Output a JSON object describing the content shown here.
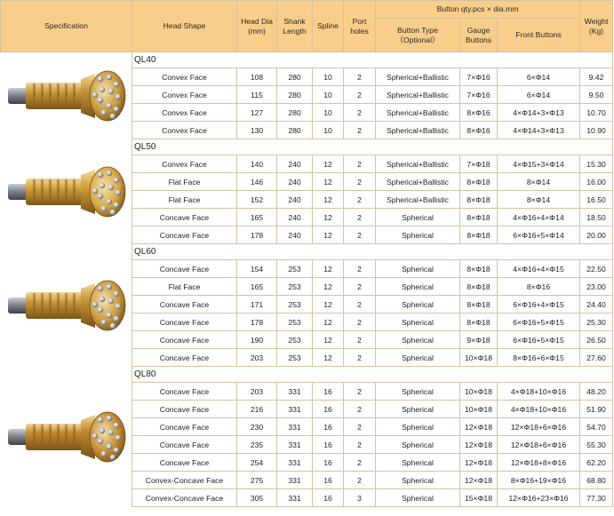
{
  "header": {
    "specification": "Specification",
    "head_shape": "Head Shape",
    "head_dia": "Head Dia\n(mm)",
    "shank_length": "Shank\nLength",
    "spline": "Spline",
    "port_holes": "Port\nholes",
    "button_group": "Button qty.pcs × dia.mm",
    "button_type": "Button Type\n（Optional）",
    "gauge_buttons": "Gauge\nButtons",
    "front_buttons": "Front Buttons",
    "weight": "Weight\n(Kg)"
  },
  "groups": [
    {
      "name": "QL40",
      "rows": [
        {
          "shape": "Convex Face",
          "dia": "108",
          "shank": "280",
          "spline": "10",
          "ports": "2",
          "type": "Spherical+Ballistic",
          "gauge": "7×Φ16",
          "front": "6×Φ14",
          "weight": "9.42"
        },
        {
          "shape": "Convex Face",
          "dia": "115",
          "shank": "280",
          "spline": "10",
          "ports": "2",
          "type": "Spherical+Ballistic",
          "gauge": "7×Φ16",
          "front": "6×Φ14",
          "weight": "9.50"
        },
        {
          "shape": "Convex Face",
          "dia": "127",
          "shank": "280",
          "spline": "10",
          "ports": "2",
          "type": "Spherical+Ballistic",
          "gauge": "8×Φ16",
          "front": "4×Φ14+3×Φ13",
          "weight": "10.70"
        },
        {
          "shape": "Convex Face",
          "dia": "130",
          "shank": "280",
          "spline": "10",
          "ports": "2",
          "type": "Spherical+Ballistic",
          "gauge": "8×Φ16",
          "front": "4×Φ14+3×Φ13",
          "weight": "10.90"
        }
      ]
    },
    {
      "name": "QL50",
      "rows": [
        {
          "shape": "Convex Face",
          "dia": "140",
          "shank": "240",
          "spline": "12",
          "ports": "2",
          "type": "Spherical+Ballistic",
          "gauge": "7×Φ18",
          "front": "4×Φ15+3×Φ14",
          "weight": "15.30"
        },
        {
          "shape": "Flat Face",
          "dia": "146",
          "shank": "240",
          "spline": "12",
          "ports": "2",
          "type": "Spherical+Ballistic",
          "gauge": "8×Φ18",
          "front": "8×Φ14",
          "weight": "16.00"
        },
        {
          "shape": "Flat Face",
          "dia": "152",
          "shank": "240",
          "spline": "12",
          "ports": "2",
          "type": "Spherical+Ballistic",
          "gauge": "8×Φ18",
          "front": "8×Φ14",
          "weight": "16.50"
        },
        {
          "shape": "Concave Face",
          "dia": "165",
          "shank": "240",
          "spline": "12",
          "ports": "2",
          "type": "Spherical",
          "gauge": "8×Φ18",
          "front": "4×Φ16+4×Φ14",
          "weight": "18.50"
        },
        {
          "shape": "Concave Face",
          "dia": "178",
          "shank": "240",
          "spline": "12",
          "ports": "2",
          "type": "Spherical",
          "gauge": "8×Φ18",
          "front": "6×Φ16+5×Φ14",
          "weight": "20.00"
        }
      ]
    },
    {
      "name": "QL60",
      "rows": [
        {
          "shape": "Concave Face",
          "dia": "154",
          "shank": "253",
          "spline": "12",
          "ports": "2",
          "type": "Spherical",
          "gauge": "8×Φ18",
          "front": "4×Φ16+4×Φ15",
          "weight": "22.50"
        },
        {
          "shape": "Flat Face",
          "dia": "165",
          "shank": "253",
          "spline": "12",
          "ports": "2",
          "type": "Spherical",
          "gauge": "8×Φ18",
          "front": "8×Φ16",
          "weight": "23.00"
        },
        {
          "shape": "Concave Face",
          "dia": "171",
          "shank": "253",
          "spline": "12",
          "ports": "2",
          "type": "Spherical",
          "gauge": "8×Φ18",
          "front": "6×Φ16+4×Φ15",
          "weight": "24.40"
        },
        {
          "shape": "Concave Face",
          "dia": "178",
          "shank": "253",
          "spline": "12",
          "ports": "2",
          "type": "Spherical",
          "gauge": "8×Φ18",
          "front": "6×Φ16+5×Φ15",
          "weight": "25.30"
        },
        {
          "shape": "Concave Face",
          "dia": "190",
          "shank": "253",
          "spline": "12",
          "ports": "2",
          "type": "Spherical",
          "gauge": "9×Φ18",
          "front": "6×Φ16+5×Φ15",
          "weight": "26.50"
        },
        {
          "shape": "Concave Face",
          "dia": "203",
          "shank": "253",
          "spline": "12",
          "ports": "2",
          "type": "Spherical",
          "gauge": "10×Φ18",
          "front": "8×Φ16+6×Φ15",
          "weight": "27.60"
        }
      ]
    },
    {
      "name": "QL80",
      "rows": [
        {
          "shape": "Concave Face",
          "dia": "203",
          "shank": "331",
          "spline": "16",
          "ports": "2",
          "type": "Spherical",
          "gauge": "10×Φ18",
          "front": "4×Φ18+10×Φ16",
          "weight": "48.20"
        },
        {
          "shape": "Concave Face",
          "dia": "216",
          "shank": "331",
          "spline": "16",
          "ports": "2",
          "type": "Spherical",
          "gauge": "10×Φ18",
          "front": "4×Φ18+10×Φ16",
          "weight": "51.90"
        },
        {
          "shape": "Concave Face",
          "dia": "230",
          "shank": "331",
          "spline": "16",
          "ports": "2",
          "type": "Spherical",
          "gauge": "12×Φ18",
          "front": "12×Φ18+6×Φ16",
          "weight": "54.70"
        },
        {
          "shape": "Concave Face",
          "dia": "235",
          "shank": "331",
          "spline": "16",
          "ports": "2",
          "type": "Spherical",
          "gauge": "12×Φ18",
          "front": "12×Φ18+6×Φ16",
          "weight": "55.30"
        },
        {
          "shape": "Concave Face",
          "dia": "254",
          "shank": "331",
          "spline": "16",
          "ports": "2",
          "type": "Spherical",
          "gauge": "12×Φ18",
          "front": "12×Φ18+8×Φ16",
          "weight": "62.20"
        },
        {
          "shape": "Convex-Concave Face",
          "dia": "275",
          "shank": "331",
          "spline": "16",
          "ports": "2",
          "type": "Spherical",
          "gauge": "12×Φ18",
          "front": "8×Φ16+19×Φ16",
          "weight": "68.80"
        },
        {
          "shape": "Convex-Concave Face",
          "dia": "305",
          "shank": "331",
          "spline": "16",
          "ports": "3",
          "type": "Spherical",
          "gauge": "15×Φ18",
          "front": "12×Φ16+23×Φ16",
          "weight": "77.30"
        }
      ]
    }
  ],
  "images": [
    {
      "icon": "drill-bit-icon",
      "color": "#c9993c"
    },
    {
      "icon": "drill-bit-icon",
      "color": "#d6a640"
    },
    {
      "icon": "drill-bit-icon",
      "color": "#c9993c"
    },
    {
      "icon": "drill-bit-icon",
      "color": "#c28a32"
    }
  ],
  "colors": {
    "header_bg": "#f9cd8a",
    "border": "#d3c3a2",
    "bit_body": "#c9993c",
    "bit_shank": "#7a7f86"
  }
}
